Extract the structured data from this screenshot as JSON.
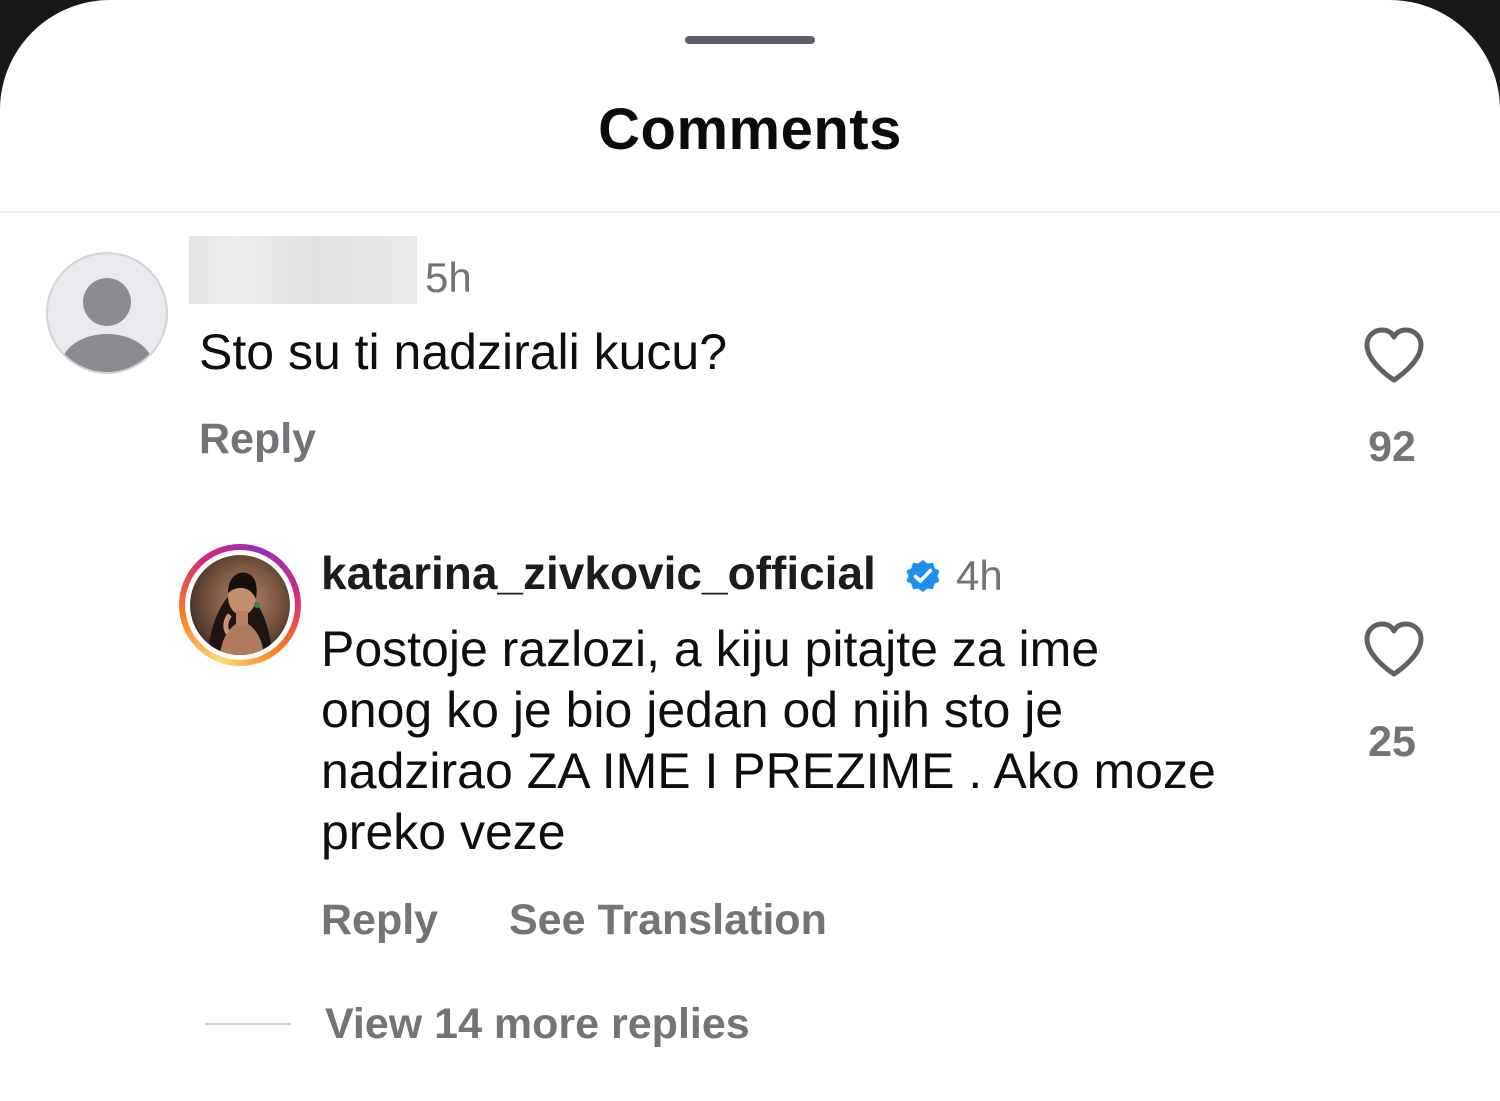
{
  "sheet": {
    "title": "Comments"
  },
  "comments": [
    {
      "username": "",
      "time": "5h",
      "text": "Sto su ti nadzirali kucu?",
      "reply_label": "Reply",
      "like_count": "92",
      "avatar_icon": "default-avatar-icon"
    }
  ],
  "replies": [
    {
      "username": "katarina_zivkovic_official",
      "verified": true,
      "time": "4h",
      "text_lines": [
        "Postoje razlozi, a kiju pitajte za ime",
        "onog ko je bio jedan od njih sto je",
        "nadzirao ZA IME I PREZIME . Ako moze",
        "preko veze"
      ],
      "reply_label": "Reply",
      "translation_label": "See Translation",
      "like_count": "25",
      "has_story": true
    }
  ],
  "thread": {
    "view_more_label": "View 14 more replies"
  },
  "icons": {
    "like": "heart-outline-icon",
    "verified": "verified-badge-icon"
  },
  "colors": {
    "verified_blue": "#0095f6",
    "secondary_text": "#737378",
    "primary_text": "#0e0e0e"
  }
}
